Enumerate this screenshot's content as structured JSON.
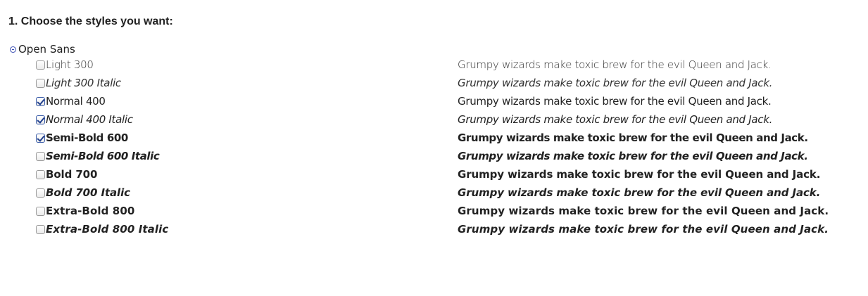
{
  "heading": "1. Choose the styles you want:",
  "family": {
    "name": "Open Sans",
    "icon": "collapse-circle-icon"
  },
  "sample_text": "Grumpy wizards make toxic brew for the evil Queen and Jack.",
  "styles": [
    {
      "label": "Light 300",
      "checked": false,
      "weight": "300",
      "italic": false
    },
    {
      "label": "Light 300 Italic",
      "checked": false,
      "weight": "300",
      "italic": true
    },
    {
      "label": "Normal 400",
      "checked": true,
      "weight": "400",
      "italic": false
    },
    {
      "label": "Normal 400 Italic",
      "checked": true,
      "weight": "400",
      "italic": true
    },
    {
      "label": "Semi-Bold 600",
      "checked": true,
      "weight": "600",
      "italic": false
    },
    {
      "label": "Semi-Bold 600 Italic",
      "checked": false,
      "weight": "600",
      "italic": true
    },
    {
      "label": "Bold 700",
      "checked": false,
      "weight": "700",
      "italic": false
    },
    {
      "label": "Bold 700 Italic",
      "checked": false,
      "weight": "700",
      "italic": true
    },
    {
      "label": "Extra-Bold 800",
      "checked": false,
      "weight": "800",
      "italic": false
    },
    {
      "label": "Extra-Bold 800 Italic",
      "checked": false,
      "weight": "800",
      "italic": true
    }
  ],
  "colors": {
    "text": "#222222",
    "checkmark": "#1f3e8c"
  }
}
